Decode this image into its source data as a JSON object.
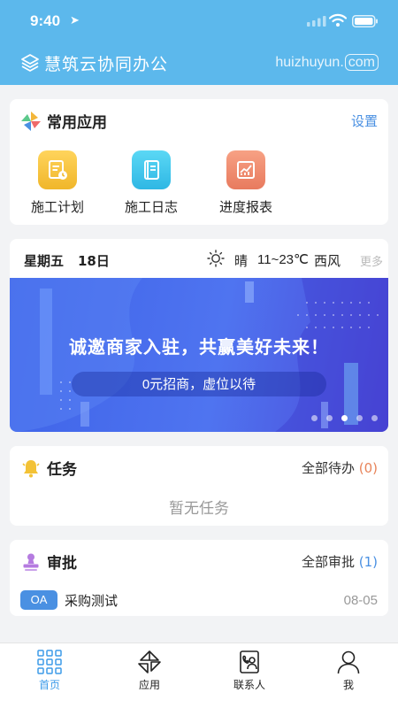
{
  "status_bar": {
    "time": "9:40"
  },
  "header": {
    "brand": "慧筑云协同办公",
    "domain_text": "huizhuyun.",
    "domain_suffix": "com"
  },
  "common_apps": {
    "title": "常用应用",
    "settings_label": "设置",
    "apps": [
      {
        "label": "施工计划",
        "icon": "construction-plan-icon",
        "color": "#f3c236"
      },
      {
        "label": "施工日志",
        "icon": "construction-log-icon",
        "color": "#3cc5e8"
      },
      {
        "label": "进度报表",
        "icon": "progress-report-icon",
        "color": "#ef8a6c"
      }
    ]
  },
  "weather": {
    "weekday": "星期五",
    "date": "18日",
    "condition": "晴",
    "temperature": "11~23℃",
    "wind": "西风",
    "more_label": "更多"
  },
  "banner": {
    "headline": "诚邀商家入驻，共赢美好未来！",
    "price": "0元",
    "subtext": "招商，虚位以待"
  },
  "tasks": {
    "title": "任务",
    "all_label": "全部待办",
    "count": "(0)",
    "empty_text": "暂无任务"
  },
  "approvals": {
    "title": "审批",
    "all_label": "全部审批",
    "count": "(1)",
    "items": [
      {
        "tag": "OA",
        "name": "采购测试",
        "date": "08-05"
      }
    ]
  },
  "tabbar": {
    "tabs": [
      {
        "label": "首页",
        "icon": "home-grid-icon",
        "active": true
      },
      {
        "label": "应用",
        "icon": "apps-icon",
        "active": false
      },
      {
        "label": "联系人",
        "icon": "contacts-icon",
        "active": false
      },
      {
        "label": "我",
        "icon": "profile-icon",
        "active": false
      }
    ]
  },
  "colors": {
    "header": "#5cb8ec",
    "accent_blue": "#4a90e2",
    "accent_orange": "#e8845a",
    "tab_active": "#3d9be9"
  }
}
